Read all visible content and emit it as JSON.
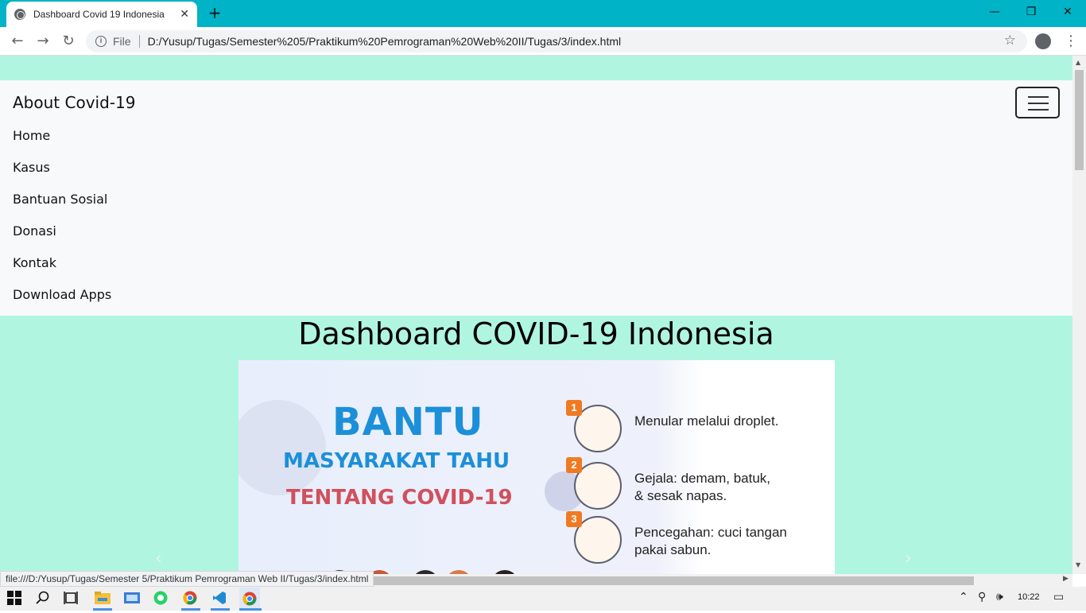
{
  "browser": {
    "tab_title": "Dashboard Covid 19 Indonesia",
    "tab_close": "✕",
    "new_tab": "+",
    "minimize": "—",
    "restore": "❐",
    "close": "✕",
    "back": "←",
    "forward": "→",
    "reload": "↻",
    "scheme_label": "File",
    "url": "D:/Yusup/Tugas/Semester%205/Praktikum%20Pemrograman%20Web%20II/Tugas/3/index.html",
    "star": "☆",
    "menu": "⋮"
  },
  "navbar": {
    "brand": "About Covid-19",
    "links": [
      "Home",
      "Kasus",
      "Bantuan Sosial",
      "Donasi",
      "Kontak",
      "Download Apps"
    ]
  },
  "main": {
    "title": "Dashboard COVID-19 Indonesia"
  },
  "carousel": {
    "headline": "BANTU",
    "subline1": "MASYARAKAT TAHU",
    "subline2": "TENTANG COVID-19",
    "steps": [
      {
        "num": "1",
        "text": "Menular melalui droplet."
      },
      {
        "num": "2",
        "text": "Gejala: demam, batuk,\n& sesak napas."
      },
      {
        "num": "3",
        "text": "Pencegahan: cuci tangan\npakai sabun."
      }
    ],
    "prev": "‹",
    "next": "›"
  },
  "status_bar": {
    "text": "file:///D:/Yusup/Tugas/Semester 5/Praktikum Pemrograman Web II/Tugas/3/index.html"
  },
  "taskbar": {
    "time": "10:22"
  },
  "colors": {
    "tabstrip": "#00b3c6",
    "page_bg": "#b0f5df",
    "navbar_bg": "#f8f9fa"
  }
}
